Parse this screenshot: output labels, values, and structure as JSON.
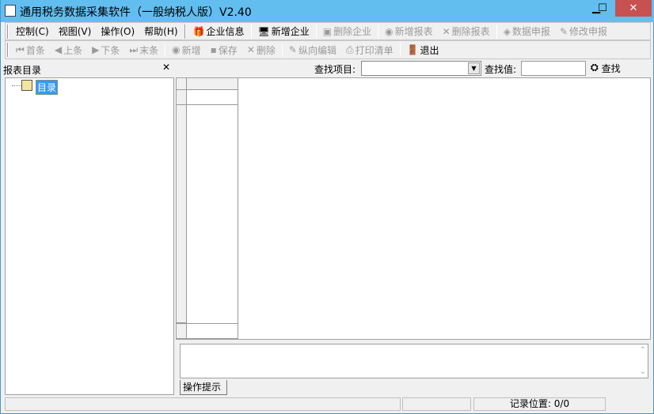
{
  "window": {
    "title": "通用税务数据采集软件（一般纳税人版）V2.40",
    "minimize": "▁",
    "maximize": "☐",
    "close": "✕"
  },
  "menu": [
    {
      "label": "控制(C)"
    },
    {
      "label": "视图(V)"
    },
    {
      "label": "操作(O)"
    },
    {
      "label": "帮助(H)"
    }
  ],
  "toolbar1": [
    {
      "label": "企业信息",
      "icon": "company-info-icon",
      "glyph": "🎁",
      "enabled": true
    },
    {
      "label": "新增企业",
      "icon": "add-company-icon",
      "glyph": "🖥",
      "enabled": true
    },
    {
      "label": "删除企业",
      "icon": "delete-company-icon",
      "glyph": "▣",
      "enabled": false
    },
    {
      "label": "新增报表",
      "icon": "add-report-icon",
      "glyph": "◉",
      "enabled": false
    },
    {
      "label": "删除报表",
      "icon": "delete-report-icon",
      "glyph": "✕",
      "enabled": false
    },
    {
      "label": "数据申报",
      "icon": "data-declare-icon",
      "glyph": "◈",
      "enabled": false
    },
    {
      "label": "修改申报",
      "icon": "modify-declare-icon",
      "glyph": "✎",
      "enabled": false
    }
  ],
  "toolbar2": [
    {
      "label": "首条",
      "icon": "first-record-icon",
      "glyph": "⏮",
      "enabled": false
    },
    {
      "label": "上条",
      "icon": "prev-record-icon",
      "glyph": "◀",
      "enabled": false
    },
    {
      "label": "下条",
      "icon": "next-record-icon",
      "glyph": "▶",
      "enabled": false
    },
    {
      "label": "末条",
      "icon": "last-record-icon",
      "glyph": "⏭",
      "enabled": false
    },
    {
      "label": "新增",
      "icon": "add-icon",
      "glyph": "◉",
      "enabled": false
    },
    {
      "label": "保存",
      "icon": "save-icon",
      "glyph": "▪",
      "enabled": false
    },
    {
      "label": "删除",
      "icon": "delete-icon",
      "glyph": "✕",
      "enabled": false
    },
    {
      "label": "纵向编辑",
      "icon": "vertical-edit-icon",
      "glyph": "✎",
      "enabled": false
    },
    {
      "label": "打印清单",
      "icon": "print-icon",
      "glyph": "⎙",
      "enabled": false
    },
    {
      "label": "退出",
      "icon": "exit-icon",
      "glyph": "🚪",
      "enabled": true
    }
  ],
  "search": {
    "item_label": "查找项目:",
    "item_value": "",
    "value_label": "查找值:",
    "value": "",
    "button": "查找"
  },
  "left_panel": {
    "title": "报表目录",
    "close": "✕",
    "tree": [
      {
        "label": "目录"
      }
    ]
  },
  "tips_tab": "操作提示",
  "status": {
    "record_position": "记录位置: 0/0"
  }
}
